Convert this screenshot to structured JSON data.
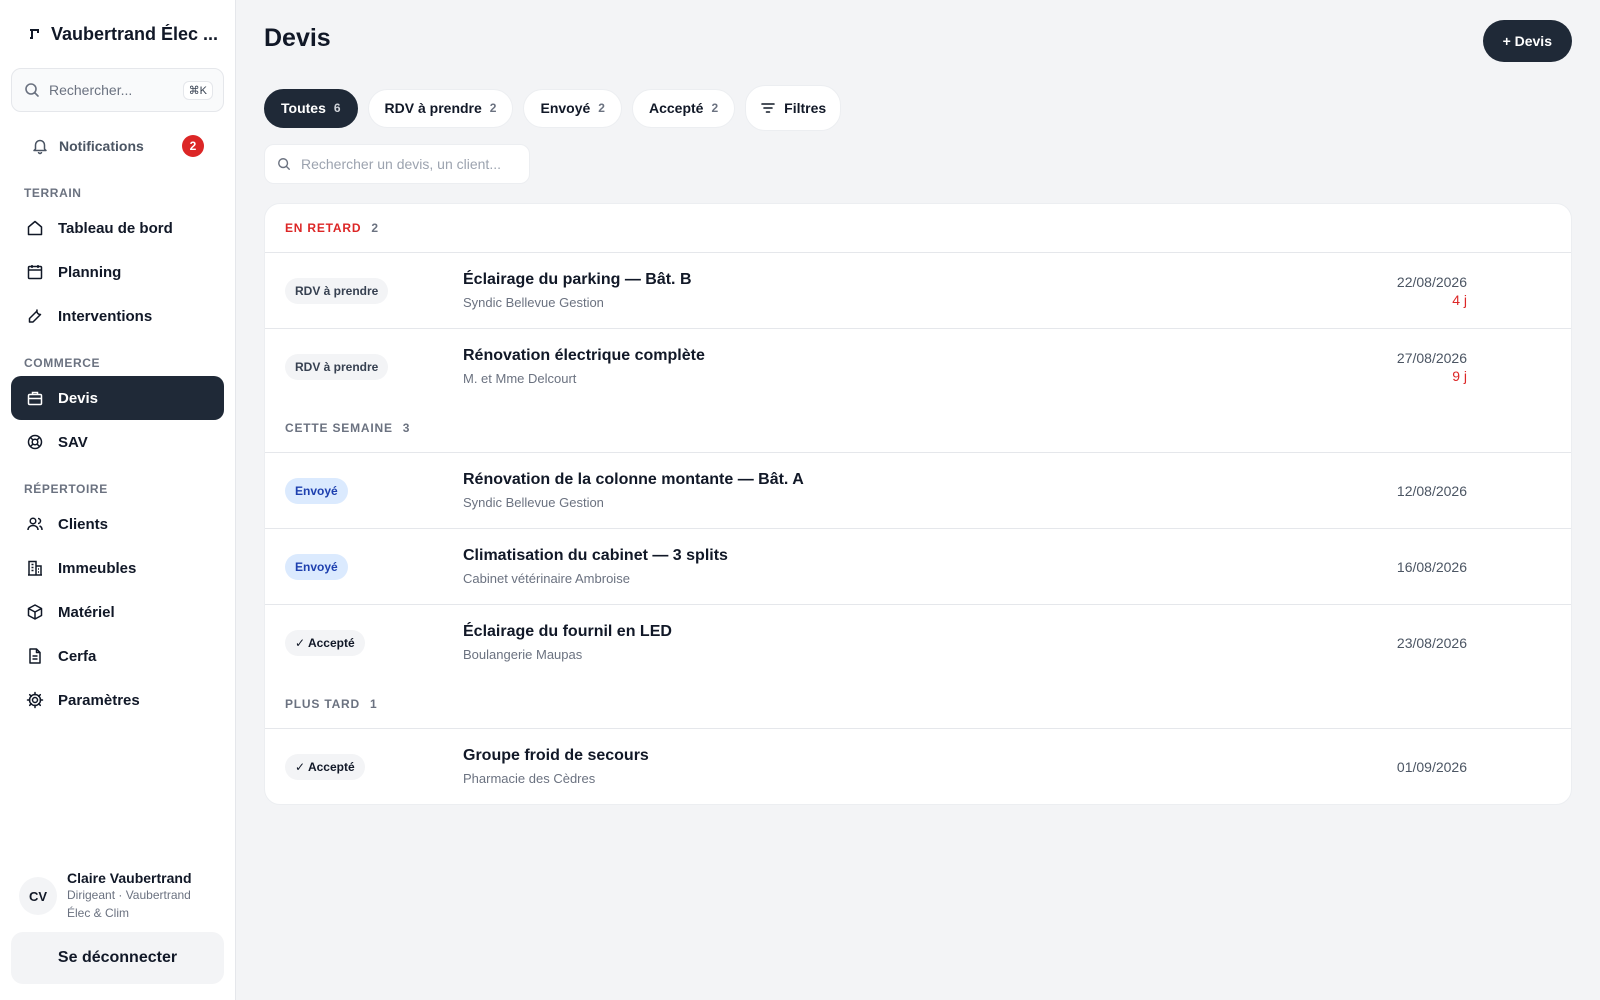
{
  "sidebar": {
    "brand": "Vaubertrand Élec ...",
    "search_placeholder": "Rechercher...",
    "search_shortcut": "⌘K",
    "notifications": {
      "label": "Notifications",
      "count": "2"
    },
    "sections": [
      {
        "title": "TERRAIN",
        "items": [
          "Tableau de bord",
          "Planning",
          "Interventions"
        ]
      },
      {
        "title": "COMMERCE",
        "items": [
          "Devis",
          "SAV"
        ]
      },
      {
        "title": "RÉPERTOIRE",
        "items": [
          "Clients",
          "Immeubles",
          "Matériel",
          "Cerfa",
          "Paramètres"
        ]
      }
    ],
    "nav": {
      "dashboard": "Tableau de bord",
      "planning": "Planning",
      "interventions": "Interventions",
      "devis": "Devis",
      "sav": "SAV",
      "clients": "Clients",
      "immeubles": "Immeubles",
      "materiel": "Matériel",
      "cerfa": "Cerfa",
      "parametres": "Paramètres"
    },
    "section_titles": {
      "terrain": "TERRAIN",
      "commerce": "COMMERCE",
      "repertoire": "RÉPERTOIRE"
    },
    "user": {
      "initials": "CV",
      "name": "Claire Vaubertrand",
      "role": "Dirigeant · Vaubertrand Élec & Clim"
    },
    "logout_label": "Se déconnecter",
    "active_item": "Devis"
  },
  "main": {
    "title": "Devis",
    "add_button": "+ Devis",
    "tabs": [
      {
        "label": "Toutes",
        "count": "6"
      },
      {
        "label": "RDV à prendre",
        "count": "2"
      },
      {
        "label": "Envoyé",
        "count": "2"
      },
      {
        "label": "Accepté",
        "count": "2"
      }
    ],
    "filters_label": "Filtres",
    "list_search_placeholder": "Rechercher un devis, un client..."
  },
  "groups": [
    {
      "title": "EN RETARD",
      "count": "2",
      "rows": [
        {
          "status": "RDV à prendre",
          "title": "Éclairage du parking — Bât. B",
          "client": "Syndic Bellevue Gestion",
          "date": "22/08/2026",
          "late": "4 j"
        },
        {
          "status": "RDV à prendre",
          "title": "Rénovation électrique complète",
          "client": "M. et Mme Delcourt",
          "date": "27/08/2026",
          "late": "9 j"
        }
      ]
    },
    {
      "title": "CETTE SEMAINE",
      "count": "3",
      "rows": [
        {
          "status": "Envoyé",
          "title": "Rénovation de la colonne montante — Bât. A",
          "client": "Syndic Bellevue Gestion",
          "date": "12/08/2026"
        },
        {
          "status": "Envoyé",
          "title": "Climatisation du cabinet — 3 splits",
          "client": "Cabinet vétérinaire Ambroise",
          "date": "16/08/2026"
        },
        {
          "status": "✓ Accepté",
          "title": "Éclairage du fournil en LED",
          "client": "Boulangerie Maupas",
          "date": "23/08/2026"
        }
      ]
    },
    {
      "title": "PLUS TARD",
      "count": "1",
      "rows": [
        {
          "status": "✓ Accepté",
          "title": "Groupe froid de secours",
          "client": "Pharmacie des Cèdres",
          "date": "01/09/2026"
        }
      ]
    }
  ],
  "colors": {
    "accent_dark": "#1f2937",
    "late_red": "#dc2626",
    "sent_blue_bg": "#dbeafe"
  }
}
